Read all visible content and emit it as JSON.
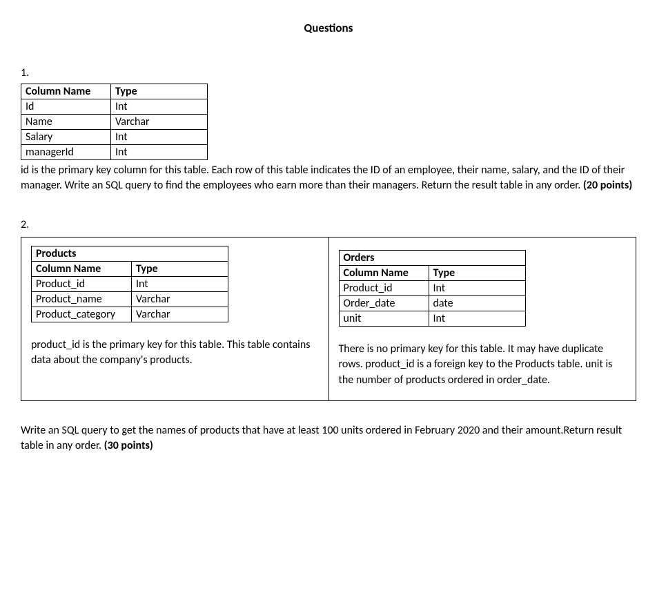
{
  "title": "Questions",
  "q1": {
    "number": "1.",
    "col_header": "Column Name",
    "type_header": "Type",
    "rows": [
      {
        "name": "Id",
        "type": "Int"
      },
      {
        "name": "Name",
        "type": "Varchar"
      },
      {
        "name": "Salary",
        "type": "Int"
      },
      {
        "name": "managerId",
        "type": "Int"
      }
    ],
    "desc_pre": "id is the primary key column for this table. Each row of this table indicates the ID of an employee, their name, salary, and the ID of their manager. Write an SQL query to find the employees who earn more than their managers. Return the result table in any order. ",
    "points": "(20 points)"
  },
  "q2": {
    "number": "2.",
    "products": {
      "table_name": "Products",
      "col_header": "Column Name",
      "type_header": "Type",
      "rows": [
        {
          "name": "Product_id",
          "type": "Int"
        },
        {
          "name": "Product_name",
          "type": "Varchar"
        },
        {
          "name": "Product_category",
          "type": "Varchar"
        }
      ],
      "desc": "product_id is the primary key for this table. This table contains data about the company's products."
    },
    "orders": {
      "table_name": "Orders",
      "col_header": "Column Name",
      "type_header": "Type",
      "rows": [
        {
          "name": "Product_id",
          "type": "Int"
        },
        {
          "name": "Order_date",
          "type": "date"
        },
        {
          "name": "unit",
          "type": "Int"
        }
      ],
      "desc": "There is no primary key for this table. It may have duplicate rows. product_id is a foreign key to the Products table. unit is the number of products ordered in order_date."
    },
    "desc_pre": "Write an SQL query to get the names of products that have at least 100 units ordered in February 2020 and their amount.Return result table in any order. ",
    "points": "(30 points)"
  }
}
